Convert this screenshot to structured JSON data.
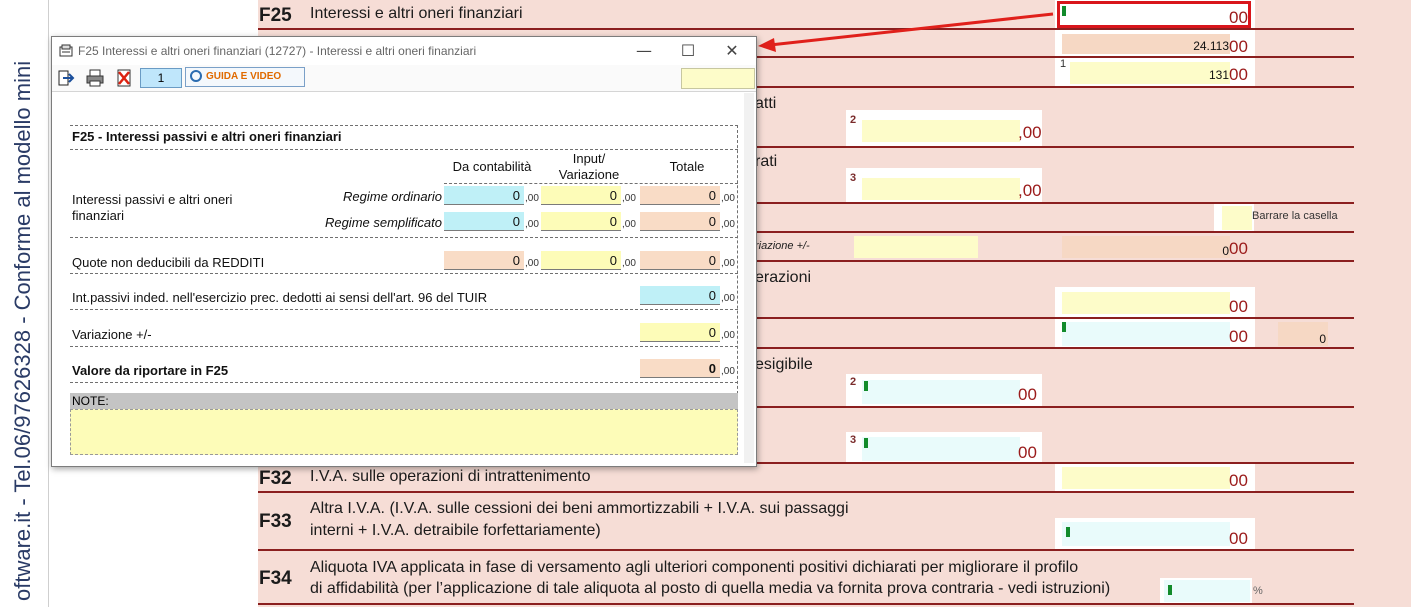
{
  "sidebar": {
    "vertical_text": "oftware.it - Tel.06/97626328 - Conforme al modello mini"
  },
  "form": {
    "rows": {
      "f25": {
        "code": "F25",
        "label": "Interessi e altri oneri finanziari"
      },
      "f32": {
        "code": "F32",
        "label": "I.V.A. sulle operazioni di intrattenimento"
      },
      "f33": {
        "code": "F33",
        "label_line1": "Altra I.V.A. (I.V.A. sulle cessioni dei beni ammortizzabili + I.V.A. sui passaggi",
        "label_line2": "interni + I.V.A. detraibile forfettariamente)"
      },
      "f34": {
        "code": "F34",
        "label_line1": "Aliquota IVA applicata in fase di versamento agli ulteriori componenti positivi dichiarati per migliorare il profilo",
        "label_line2": "di affidabilità (per l’applicazione di tale aliquota al posto di quella media va fornita prova contraria - vedi istruzioni)"
      }
    },
    "partial_labels": {
      "atti": "atti",
      "rati": "rati",
      "erazioni": "erazioni",
      "esigibile": "esigibile",
      "variazione": "riazione +/-",
      "barrare": "Barrare la casella"
    },
    "values": {
      "v24113": "24.113",
      "v131": "131",
      "zero": "0",
      "zero_small": "0",
      "oo": "00",
      "oo_comma": ",00",
      "pct": "%",
      "sup1": "1",
      "sup2": "2",
      "sup3": "3"
    }
  },
  "dialog": {
    "title": "F25 Interessi e altri oneri finanziari (12727) - Interessi e altri oneri finanziari",
    "page_number": "1",
    "guida_label": "GUIDA E VIDEO",
    "section_title": "F25 - Interessi passivi e altri oneri finanziari",
    "columns": {
      "contabilita": "Da contabilità",
      "input_line1": "Input/",
      "input_line2": "Variazione",
      "totale": "Totale"
    },
    "rows": {
      "interessi_label_line1": "Interessi passivi e altri oneri",
      "interessi_label_line2": "finanziari",
      "regime_ordinario": "Regime ordinario",
      "regime_semplificato": "Regime semplificato",
      "quote_non_deducibili": "Quote non deducibili da REDDITI",
      "int_passivi_indeducibili": "Int.passivi inded. nell'esercizio prec. dedotti ai sensi dell'art. 96 del TUIR",
      "variazione": "Variazione +/-",
      "valore_f25": "Valore da riportare in F25"
    },
    "cell_value": "0",
    "cents": ",00",
    "note_label": "NOTE:",
    "window_controls": {
      "minimize": "—",
      "maximize": "☐",
      "close": "✕"
    }
  },
  "colors": {
    "form_bg": "#f6ddd6",
    "form_rule": "#8b1f1f",
    "highlight_red": "#d9151b",
    "cell_cyan": "#bff0f7",
    "cell_yellow": "#fdfcb8",
    "cell_peach": "#f9dcc6"
  },
  "icons": [
    "app-icon",
    "exit-icon",
    "print-icon",
    "delete-icon",
    "help-icon",
    "red-arrow-annotation"
  ]
}
